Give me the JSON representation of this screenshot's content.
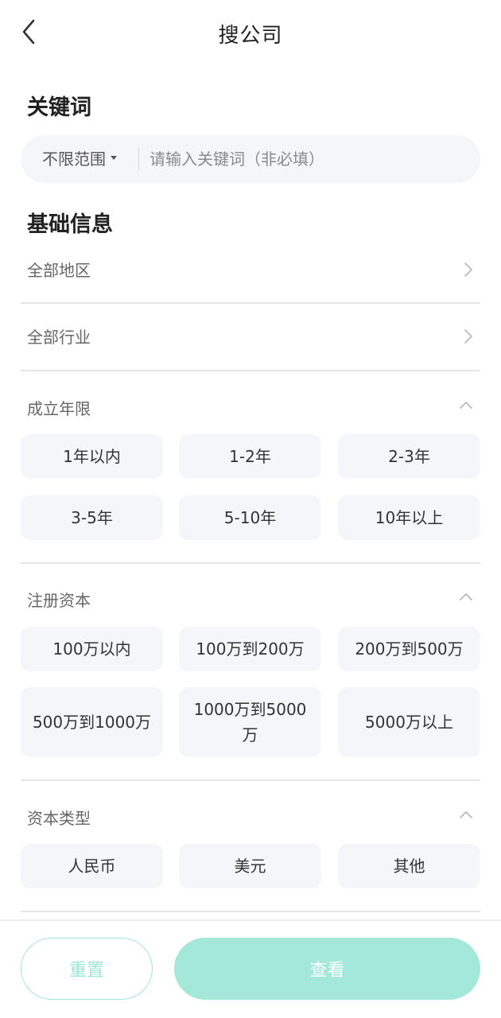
{
  "header": {
    "title": "搜公司",
    "back_icon": "chevron-left-icon"
  },
  "keyword": {
    "section_title": "关键词",
    "scope_label": "不限范围",
    "placeholder": "请输入关键词（非必填）",
    "value": ""
  },
  "basic": {
    "section_title": "基础信息",
    "region": {
      "label": "全部地区",
      "icon": "chevron-right-icon"
    },
    "industry": {
      "label": "全部行业",
      "icon": "chevron-right-icon"
    }
  },
  "years": {
    "label": "成立年限",
    "icon": "chevron-up-icon",
    "options": [
      "1年以内",
      "1-2年",
      "2-3年",
      "3-5年",
      "5-10年",
      "10年以上"
    ]
  },
  "capital": {
    "label": "注册资本",
    "icon": "chevron-up-icon",
    "options": [
      "100万以内",
      "100万到200万",
      "200万到500万",
      "500万到1000万",
      "1000万到5000万",
      "5000万以上"
    ]
  },
  "capital_type": {
    "label": "资本类型",
    "icon": "chevron-up-icon",
    "options": [
      "人民币",
      "美元",
      "其他"
    ]
  },
  "footer": {
    "reset_label": "重置",
    "view_label": "查看"
  },
  "colors": {
    "accent": "#a3e8d9",
    "accent_border": "#9fe5d7",
    "chip_bg": "#f4f6f9",
    "search_bg": "#f5f6f8"
  }
}
